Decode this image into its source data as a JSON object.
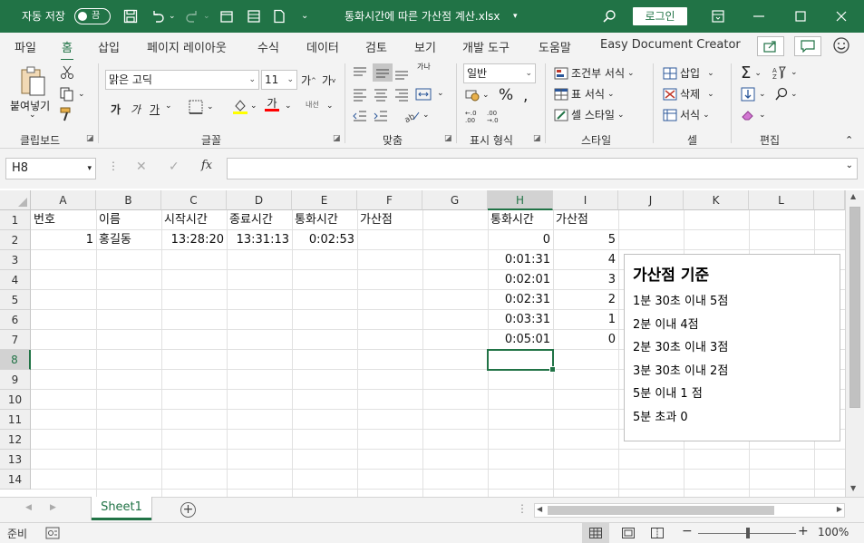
{
  "titlebar": {
    "autosave_label": "자동 저장",
    "autosave_state": "끔",
    "filename": "통화시간에 따른 가산점 계산.xlsx",
    "login_label": "로그인",
    "bg_color": "#217346"
  },
  "menu": {
    "items": [
      "파일",
      "홈",
      "삽입",
      "페이지 레이아웃",
      "수식",
      "데이터",
      "검토",
      "보기",
      "개발 도구",
      "도움말",
      "Easy Document Creator"
    ],
    "active": "홈"
  },
  "ribbon": {
    "clipboard": {
      "paste_label": "붙여넣기",
      "group_label": "클립보드"
    },
    "font": {
      "font_name": "맑은 고딕",
      "font_size": "11",
      "group_label": "글꼴",
      "bold": "가",
      "italic": "가",
      "underline": "가",
      "highlight": "가",
      "grow": "가",
      "shrink": "가",
      "phonetic": "내선"
    },
    "alignment": {
      "group_label": "맞춤",
      "wrap": "가나"
    },
    "number": {
      "format": "일반",
      "group_label": "표시 형식",
      "percent": "%"
    },
    "styles": {
      "conditional": "조건부 서식",
      "table": "표 서식",
      "cell": "셀 스타일",
      "group_label": "스타일"
    },
    "cells": {
      "insert": "삽입",
      "delete": "삭제",
      "format": "서식",
      "group_label": "셀"
    },
    "editing": {
      "group_label": "편집"
    }
  },
  "formula_bar": {
    "name_box": "H8",
    "formula": ""
  },
  "grid": {
    "columns": [
      "A",
      "B",
      "C",
      "D",
      "E",
      "F",
      "G",
      "H",
      "I",
      "J",
      "K",
      "L"
    ],
    "rows": [
      "1",
      "2",
      "3",
      "4",
      "5",
      "6",
      "7",
      "8",
      "9",
      "10",
      "11",
      "12",
      "13",
      "14"
    ],
    "selected_col": "H",
    "selected_row": "8",
    "headers_row1": {
      "A": "번호",
      "B": "이름",
      "C": "시작시간",
      "D": "종료시간",
      "E": "통화시간",
      "F": "가산점",
      "H": "통화시간",
      "I": "가산점"
    },
    "row2": {
      "A": "1",
      "B": "홍길동",
      "C": "13:28:20",
      "D": "13:31:13",
      "E": "0:02:53"
    },
    "lookup": [
      {
        "time": "0",
        "score": "5"
      },
      {
        "time": "0:01:31",
        "score": "4"
      },
      {
        "time": "0:02:01",
        "score": "3"
      },
      {
        "time": "0:02:31",
        "score": "2"
      },
      {
        "time": "0:03:31",
        "score": "1"
      },
      {
        "time": "0:05:01",
        "score": "0"
      }
    ]
  },
  "textbox": {
    "title": "가산점 기준",
    "lines": [
      "1분 30초 이내 5점",
      "2분 이내 4점",
      "2분 30초 이내 3점",
      "3분 30초 이내 2점",
      "5분 이내 1 점",
      "5분 초과 0"
    ]
  },
  "sheets": {
    "active": "Sheet1"
  },
  "statusbar": {
    "mode": "준비",
    "zoom": "100%"
  }
}
